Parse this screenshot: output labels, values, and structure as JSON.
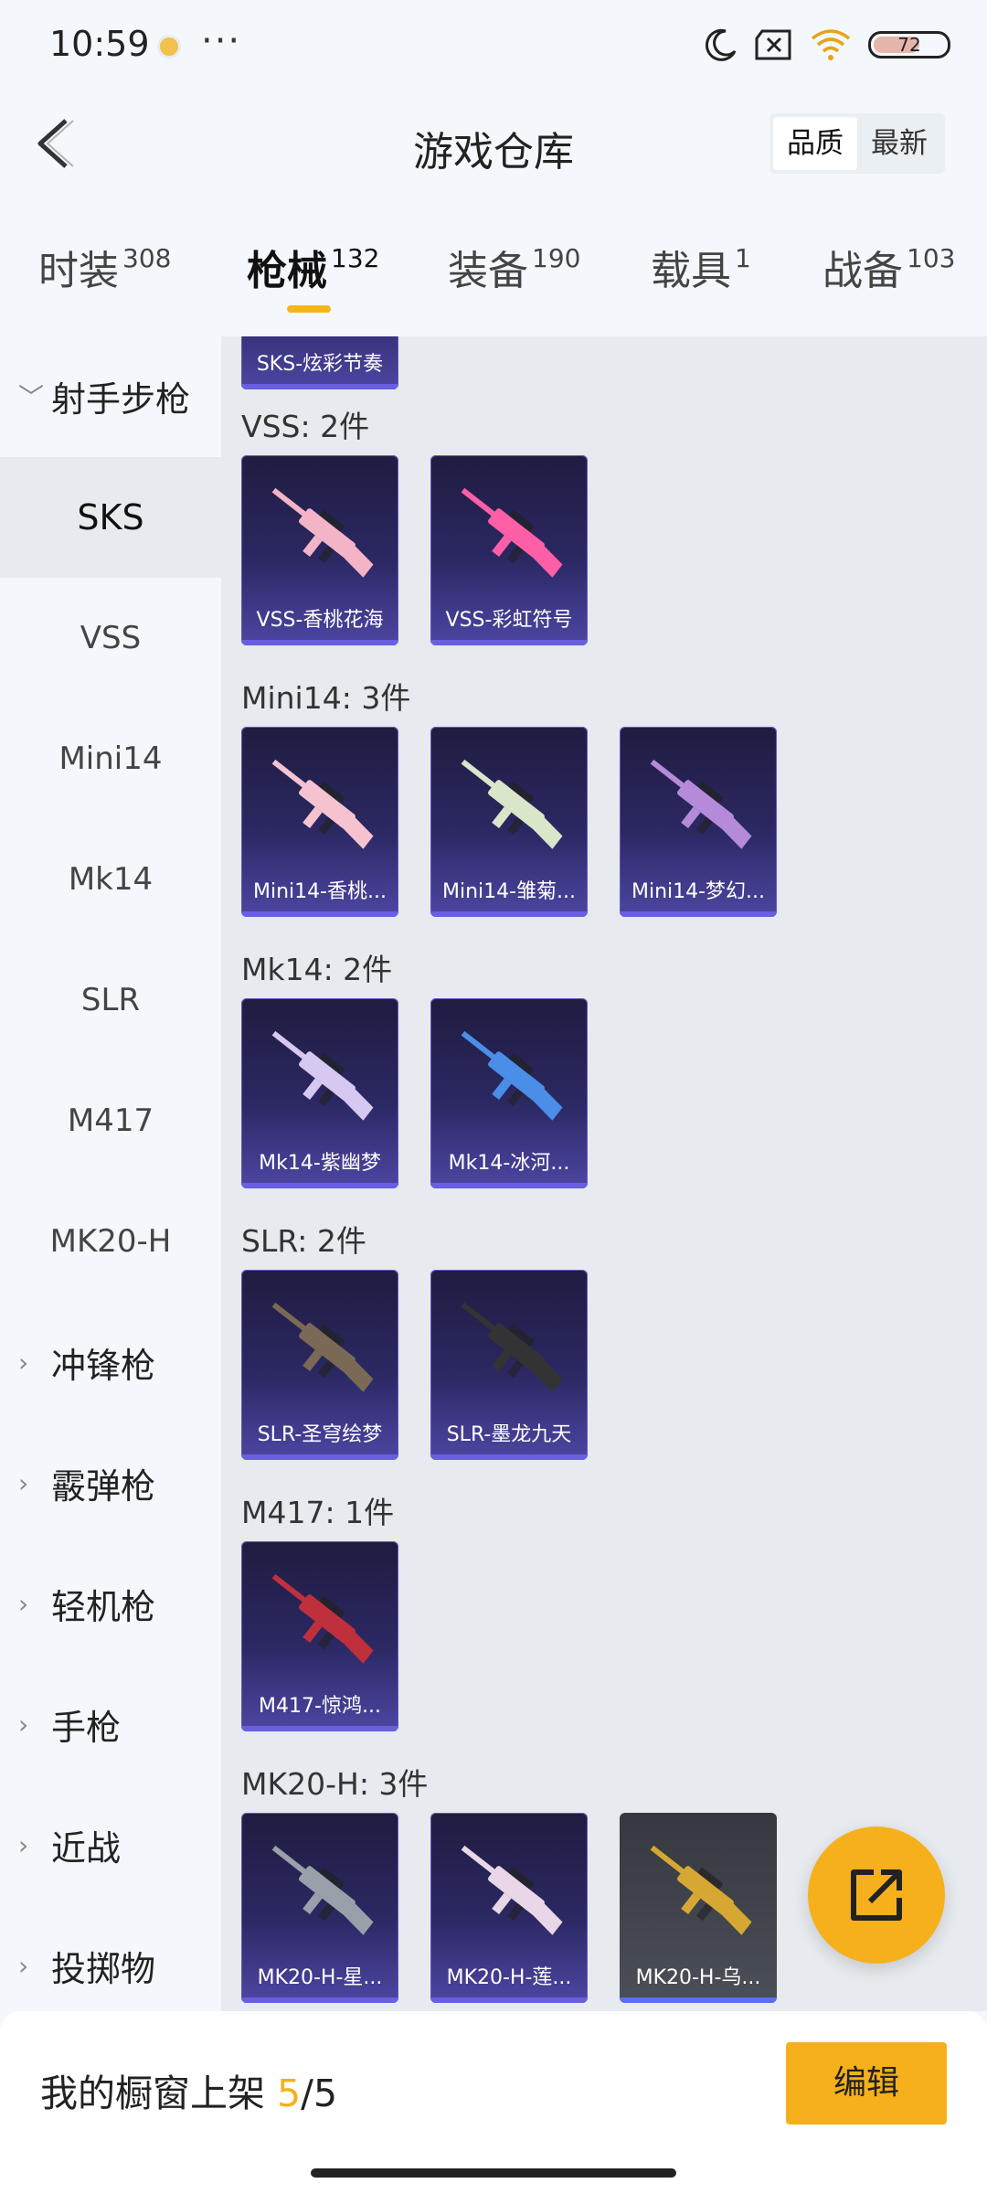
{
  "status": {
    "time": "10:59",
    "battery": "72"
  },
  "header": {
    "title": "游戏仓库",
    "sort_options": [
      "品质",
      "最新"
    ],
    "sort_selected": 0
  },
  "tabs": [
    {
      "label": "时装",
      "count": "308"
    },
    {
      "label": "枪械",
      "count": "132"
    },
    {
      "label": "装备",
      "count": "190"
    },
    {
      "label": "载具",
      "count": "1"
    },
    {
      "label": "战备",
      "count": "103"
    }
  ],
  "active_tab": 1,
  "sidebar": {
    "current_group": "射手步枪",
    "subitems": [
      "SKS",
      "VSS",
      "Mini14",
      "Mk14",
      "SLR",
      "M417",
      "MK20-H"
    ],
    "selected": "SKS",
    "groups": [
      "冲锋枪",
      "霰弹枪",
      "轻机枪",
      "手枪",
      "近战",
      "投掷物"
    ]
  },
  "content": {
    "partial_top": "SKS-炫彩节奏",
    "sections": [
      {
        "title": "VSS: 2件",
        "items": [
          "VSS-香桃花海",
          "VSS-彩虹符号"
        ]
      },
      {
        "title": "Mini14: 3件",
        "items": [
          "Mini14-香桃...",
          "Mini14-雏菊...",
          "Mini14-梦幻..."
        ]
      },
      {
        "title": "Mk14: 2件",
        "items": [
          "Mk14-紫幽梦",
          "Mk14-冰河..."
        ]
      },
      {
        "title": "SLR: 2件",
        "items": [
          "SLR-圣穹绘梦",
          "SLR-墨龙九天"
        ]
      },
      {
        "title": "M417: 1件",
        "items": [
          "M417-惊鸿..."
        ]
      },
      {
        "title": "MK20-H: 3件",
        "items": [
          "MK20-H-星...",
          "MK20-H-莲...",
          "MK20-H-乌..."
        ]
      }
    ],
    "gun_colors": [
      [
        "#f4b4c8",
        "#ff5fa6"
      ],
      [
        "#f5c3d0",
        "#d9e6c9",
        "#b58ad8"
      ],
      [
        "#d6c8f0",
        "#4a8ee8"
      ],
      [
        "#7a6a55",
        "#333"
      ],
      [
        "#c0303c"
      ],
      [
        "#9aa0aa",
        "#e9d6e6",
        "#d6a833"
      ]
    ]
  },
  "bottom": {
    "label": "我的橱窗上架",
    "count": "5",
    "sep": "/",
    "total": "5",
    "edit": "编辑"
  }
}
